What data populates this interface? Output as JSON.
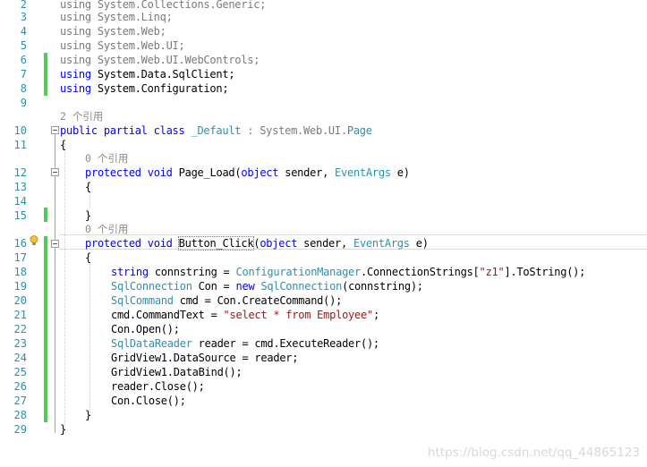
{
  "editor": {
    "line_numbers": [
      "2",
      "3",
      "4",
      "5",
      "6",
      "7",
      "8",
      "9",
      "10",
      "11",
      "12",
      "13",
      "14",
      "15",
      "16",
      "17",
      "18",
      "19",
      "20",
      "21",
      "22",
      "23",
      "24",
      "25",
      "26",
      "27",
      "28",
      "29"
    ],
    "usings": {
      "kw": "using",
      "ns2": "System.Collections.Generic;",
      "ns3": "System.Linq;",
      "ns4": "System.Web;",
      "ns5": "System.Web.UI;",
      "ns6": "System.Web.UI.WebControls;",
      "ns7": "System.Data.SqlClient;",
      "ns8": "System.Configuration;"
    },
    "lens_class": "2 个引用",
    "lens_page_load": "0 个引用",
    "lens_button_click": "0 个引用",
    "l10": {
      "kw": "public partial class",
      "name": "_Default",
      "colon": " : System.Web.UI.",
      "base": "Page"
    },
    "brace_open": "{",
    "brace_close": "}",
    "l12": {
      "kw": "protected void",
      "name": " Page_Load(",
      "objkw": "object",
      "mid": " sender, ",
      "type": "EventArgs",
      "end": " e)"
    },
    "l16": {
      "kw": "protected void",
      "name": "Button_Click",
      "open": "(",
      "objkw": "object",
      "mid": " sender, ",
      "type": "EventArgs",
      "end": " e)"
    },
    "l18": {
      "kw": "string",
      "a": " connstring = ",
      "type": "ConfigurationManager",
      "b": ".ConnectionStrings[",
      "str": "\"z1\"",
      "c": "].ToString();"
    },
    "l19": {
      "type": "SqlConnection",
      "a": " Con = ",
      "kw": "new",
      "type2": " SqlConnection",
      "b": "(connstring);"
    },
    "l20": {
      "type": "SqlCommand",
      "a": " cmd = Con.CreateCommand();"
    },
    "l21": {
      "a": "cmd.CommandText = ",
      "str": "\"select * from Employee\"",
      "b": ";"
    },
    "l22": "Con.Open();",
    "l23": {
      "type": "SqlDataReader",
      "a": " reader = cmd.ExecuteReader();"
    },
    "l24": "GridView1.DataSource = reader;",
    "l25": "GridView1.DataBind();",
    "l26": "reader.Close();",
    "l27": "Con.Close();"
  },
  "watermark": "https://blog.csdn.net/qq_44865123",
  "colors": {
    "keyword": "#0000ff",
    "type": "#2b91af",
    "string": "#a31515",
    "change_bar": "#57c95b"
  }
}
